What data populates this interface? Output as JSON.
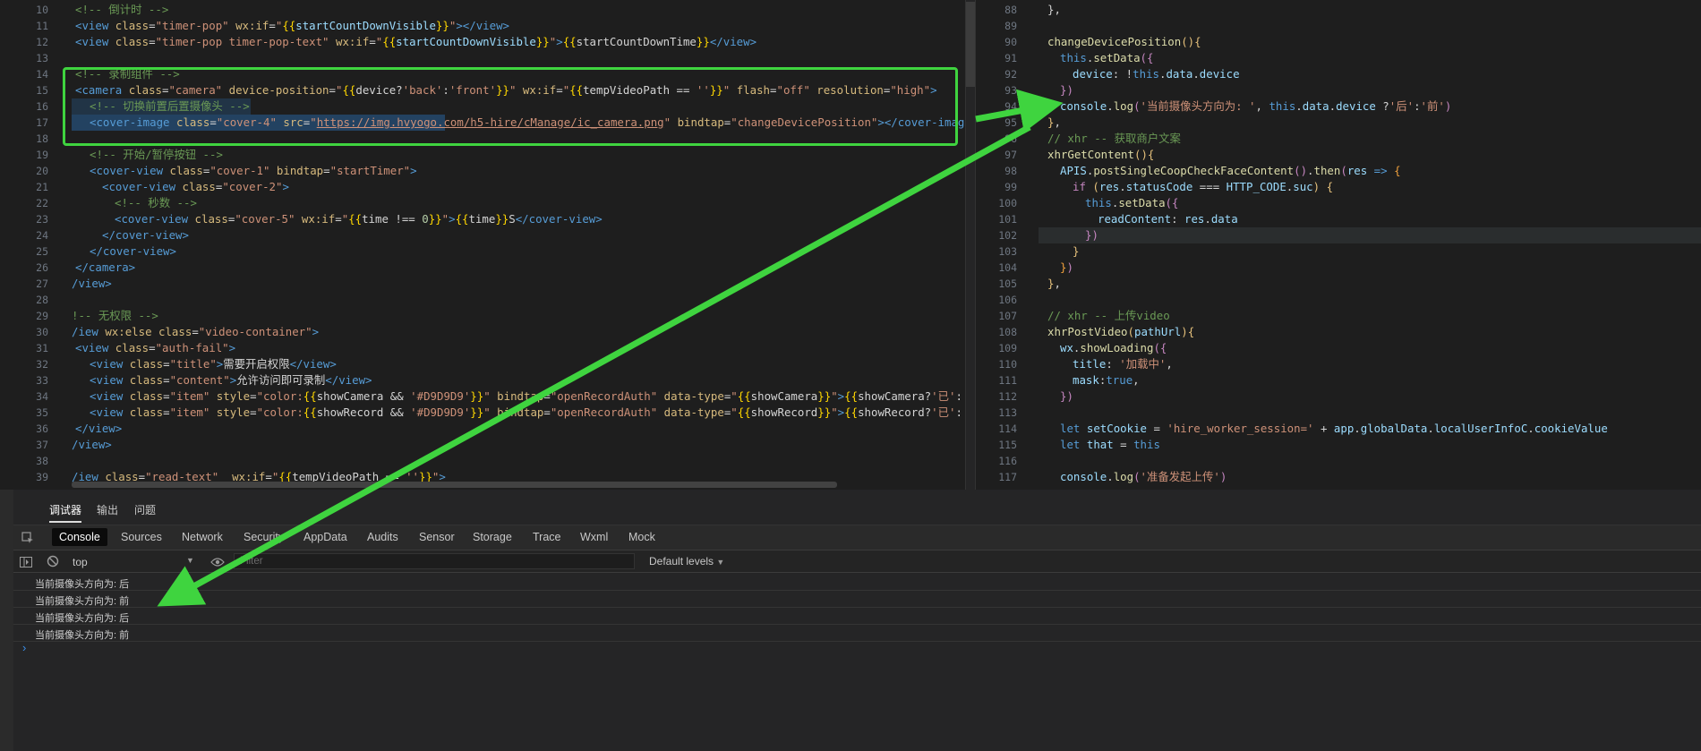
{
  "left_editor": {
    "lines": [
      {
        "n": "10",
        "html": "<span class='t-com'>&lt;!-- 倒计时 --&gt;</span>",
        "ind": 84
      },
      {
        "n": "11",
        "html": "<span class='t-tag'>&lt;view</span> <span class='t-attr'>class</span>=<span class='t-str'>\"timer-pop\"</span> <span class='t-attr'>wx:if</span>=<span class='t-str'>\"</span><span class='t-br'>{{</span><span class='t-var'>startCountDownVisible</span><span class='t-br'>}}</span><span class='t-str'>\"</span><span class='t-tag'>&gt;&lt;/view&gt;</span>",
        "ind": 84
      },
      {
        "n": "12",
        "html": "<span class='t-tag'>&lt;view</span> <span class='t-attr'>class</span>=<span class='t-str'>\"timer-pop timer-pop-text\"</span> <span class='t-attr'>wx:if</span>=<span class='t-str'>\"</span><span class='t-br'>{{</span><span class='t-var'>startCountDownVisible</span><span class='t-br'>}}</span><span class='t-str'>\"</span><span class='t-tag'>&gt;</span><span class='t-br'>{{</span>startCountDownTime<span class='t-br'>}}</span><span class='t-tag'>&lt;/view&gt;</span>",
        "ind": 84
      },
      {
        "n": "13",
        "html": "",
        "ind": 84
      },
      {
        "n": "14",
        "html": "<span class='t-com'>&lt;!-- 录制组件 --&gt;</span>",
        "ind": 84
      },
      {
        "n": "15",
        "html": "<span class='t-tag'>&lt;camera</span> <span class='t-attr'>class</span>=<span class='t-str'>\"camera\"</span> <span class='t-attr'>device-position</span>=<span class='t-str'>\"</span><span class='t-br'>{{</span>device?<span class='t-str'>'back'</span>:<span class='t-str'>'front'</span><span class='t-br'>}}</span><span class='t-str'>\"</span> <span class='t-attr'>wx:if</span>=<span class='t-str'>\"</span><span class='t-br'>{{</span>tempVideoPath == <span class='t-str'>''</span><span class='t-br'>}}</span><span class='t-str'>\"</span> <span class='t-attr'>flash</span>=<span class='t-str'>\"off\"</span> <span class='t-attr'>resolution</span>=<span class='t-str'>\"high\"</span><span class='t-tag'>&gt;</span>",
        "ind": 84
      },
      {
        "n": "16",
        "html": "<span class='t-com'>&lt;!-- 切换前置后置摄像头 --&gt;</span>",
        "ind": 100
      },
      {
        "n": "17",
        "html": "<span class='t-tag'>&lt;cover-image</span> <span class='t-attr'>class</span>=<span class='t-str'>\"cover-4\"</span> <span class='t-attr'>src</span>=<span class='t-str'>\"</span><span class='t-link'>https://img.hvyogo.com/h5-hire/cManage/ic_camera.png</span><span class='t-str'>\"</span> <span class='t-attr'>bindtap</span>=<span class='t-str'>\"changeDevicePosition\"</span><span class='t-tag'>&gt;&lt;/cover-image&gt;</span>",
        "ind": 100
      },
      {
        "n": "18",
        "html": "",
        "ind": 84
      },
      {
        "n": "19",
        "html": "<span class='t-com'>&lt;!-- 开始/暂停按钮 --&gt;</span>",
        "ind": 100
      },
      {
        "n": "20",
        "html": "<span class='t-tag'>&lt;cover-view</span> <span class='t-attr'>class</span>=<span class='t-str'>\"cover-1\"</span> <span class='t-attr'>bindtap</span>=<span class='t-str'>\"startTimer\"</span><span class='t-tag'>&gt;</span>",
        "ind": 100
      },
      {
        "n": "21",
        "html": "<span class='t-tag'>&lt;cover-view</span> <span class='t-attr'>class</span>=<span class='t-str'>\"cover-2\"</span><span class='t-tag'>&gt;</span>",
        "ind": 114
      },
      {
        "n": "22",
        "html": "<span class='t-com'>&lt;!-- 秒数 --&gt;</span>",
        "ind": 128
      },
      {
        "n": "23",
        "html": "<span class='t-tag'>&lt;cover-view</span> <span class='t-attr'>class</span>=<span class='t-str'>\"cover-5\"</span> <span class='t-attr'>wx:if</span>=<span class='t-str'>\"</span><span class='t-br'>{{</span>time !== <span class='t-num'>0</span><span class='t-br'>}}</span><span class='t-str'>\"</span><span class='t-tag'>&gt;</span><span class='t-br'>{{</span>time<span class='t-br'>}}</span>S<span class='t-tag'>&lt;/cover-view&gt;</span>",
        "ind": 128
      },
      {
        "n": "24",
        "html": "<span class='t-tag'>&lt;/cover-view&gt;</span>",
        "ind": 114
      },
      {
        "n": "25",
        "html": "<span class='t-tag'>&lt;/cover-view&gt;</span>",
        "ind": 100
      },
      {
        "n": "26",
        "html": "<span class='t-tag'>&lt;/camera&gt;</span>",
        "ind": 84
      },
      {
        "n": "27",
        "html": "<span class='t-tag'>/view&gt;</span>",
        "ind": 80
      },
      {
        "n": "28",
        "html": "",
        "ind": 80
      },
      {
        "n": "29",
        "html": "<span class='t-com'>!-- 无权限 --&gt;</span>",
        "ind": 80
      },
      {
        "n": "30",
        "html": "<span class='t-tag'>/iew</span> <span class='t-attr'>wx:else</span> <span class='t-attr'>class</span>=<span class='t-str'>\"video-container\"</span><span class='t-tag'>&gt;</span>",
        "ind": 80
      },
      {
        "n": "31",
        "html": "<span class='t-tag'>&lt;view</span> <span class='t-attr'>class</span>=<span class='t-str'>\"auth-fail\"</span><span class='t-tag'>&gt;</span>",
        "ind": 84
      },
      {
        "n": "32",
        "html": "<span class='t-tag'>&lt;view</span> <span class='t-attr'>class</span>=<span class='t-str'>\"title\"</span><span class='t-tag'>&gt;</span>需要开启权限<span class='t-tag'>&lt;/view&gt;</span>",
        "ind": 100
      },
      {
        "n": "33",
        "html": "<span class='t-tag'>&lt;view</span> <span class='t-attr'>class</span>=<span class='t-str'>\"content\"</span><span class='t-tag'>&gt;</span>允许访问即可录制<span class='t-tag'>&lt;/view&gt;</span>",
        "ind": 100
      },
      {
        "n": "34",
        "html": "<span class='t-tag'>&lt;view</span> <span class='t-attr'>class</span>=<span class='t-str'>\"item\"</span> <span class='t-attr'>style</span>=<span class='t-str'>\"color:</span><span class='t-br'>{{</span>showCamera &amp;&amp; <span class='t-str'>'#D9D9D9'</span><span class='t-br'>}}</span><span class='t-str'>\"</span> <span class='t-attr'>bindtap</span>=<span class='t-str'>\"openRecordAuth\"</span> <span class='t-attr'>data-type</span>=<span class='t-str'>\"</span><span class='t-br'>{{</span>showCamera<span class='t-br'>}}</span><span class='t-str'>\"</span><span class='t-tag'>&gt;</span><span class='t-br'>{{</span>showCamera?<span class='t-str'>'已'</span>:<span class='t-str'>''</span><span class='t-br'>}}</span>启用",
        "ind": 100
      },
      {
        "n": "35",
        "html": "<span class='t-tag'>&lt;view</span> <span class='t-attr'>class</span>=<span class='t-str'>\"item\"</span> <span class='t-attr'>style</span>=<span class='t-str'>\"color:</span><span class='t-br'>{{</span>showRecord &amp;&amp; <span class='t-str'>'#D9D9D9'</span><span class='t-br'>}}</span><span class='t-str'>\"</span> <span class='t-attr'>bindtap</span>=<span class='t-str'>\"openRecordAuth\"</span> <span class='t-attr'>data-type</span>=<span class='t-str'>\"</span><span class='t-br'>{{</span>showRecord<span class='t-br'>}}</span><span class='t-str'>\"</span><span class='t-tag'>&gt;</span><span class='t-br'>{{</span>showRecord?<span class='t-str'>'已'</span>:<span class='t-str'>''</span><span class='t-br'>}}</span>启用",
        "ind": 100
      },
      {
        "n": "36",
        "html": "<span class='t-tag'>&lt;/view&gt;</span>",
        "ind": 84
      },
      {
        "n": "37",
        "html": "<span class='t-tag'>/view&gt;</span>",
        "ind": 80
      },
      {
        "n": "38",
        "html": "",
        "ind": 80
      },
      {
        "n": "39",
        "html": "<span class='t-tag'>/iew</span> <span class='t-attr'>class</span>=<span class='t-str'>\"read-text\"</span>  <span class='t-attr'>wx:if</span>=<span class='t-str'>\"</span><span class='t-br'>{{</span>tempVideoPath == <span class='t-str'>''</span><span class='t-br'>}}</span><span class='t-str'>\"</span><span class='t-tag'>&gt;</span>",
        "ind": 80
      }
    ]
  },
  "right_editor": {
    "lines": [
      {
        "n": "88",
        "html": "<span class='t-txt'>},</span>",
        "ind": 80
      },
      {
        "n": "89",
        "html": "",
        "ind": 80
      },
      {
        "n": "90",
        "html": "<span class='t-fn'>changeDevicePosition</span><span class='t-y'>()</span><span class='t-y'>{</span>",
        "ind": 80
      },
      {
        "n": "91",
        "html": "<span class='t-kw'>this</span>.<span class='t-fn'>setData</span><span class='t-key'>({</span>",
        "ind": 94
      },
      {
        "n": "92",
        "html": "<span class='t-var'>device</span>: !<span class='t-kw'>this</span>.<span class='t-var'>data</span>.<span class='t-var'>device</span>",
        "ind": 108
      },
      {
        "n": "93",
        "html": "<span class='t-key'>})</span>",
        "ind": 94
      },
      {
        "n": "94",
        "html": "<span class='t-var'>console</span>.<span class='t-fn'>log</span><span class='t-key'>(</span><span class='t-str'>'当前摄像头方向为: '</span>, <span class='t-kw'>this</span>.<span class='t-var'>data</span>.<span class='t-var'>device</span> ?<span class='t-str'>'后'</span>:<span class='t-str'>'前'</span><span class='t-key'>)</span>",
        "ind": 94
      },
      {
        "n": "95",
        "html": "<span class='t-y'>}</span>,",
        "ind": 80
      },
      {
        "n": "96",
        "html": "<span class='t-com'>// xhr -- 获取商户文案</span>",
        "ind": 80
      },
      {
        "n": "97",
        "html": "<span class='t-fn'>xhrGetContent</span><span class='t-y'>()</span><span class='t-y'>{</span>",
        "ind": 80
      },
      {
        "n": "98",
        "html": "<span class='t-var'>APIS</span>.<span class='t-fn'>postSingleCoopCheckFaceContent</span><span class='t-key'>()</span>.<span class='t-fn'>then</span><span class='t-key'>(</span><span class='t-var'>res</span> <span class='t-kw'>=&gt;</span> <span class='t-o'>{</span>",
        "ind": 94
      },
      {
        "n": "99",
        "html": "<span class='t-key'>if</span> <span class='t-y'>(</span><span class='t-var'>res</span>.<span class='t-var'>statusCode</span> === <span class='t-var'>HTTP_CODE</span>.<span class='t-var'>suc</span><span class='t-y'>)</span> <span class='t-y'>{</span>",
        "ind": 108
      },
      {
        "n": "100",
        "html": "<span class='t-kw'>this</span>.<span class='t-fn'>setData</span><span class='t-key'>({</span>",
        "ind": 122
      },
      {
        "n": "101",
        "html": "<span class='t-var'>readContent</span>: <span class='t-var'>res</span>.<span class='t-var'>data</span>",
        "ind": 136
      },
      {
        "n": "102",
        "html": "<span class='t-key'>})</span>",
        "ind": 122
      },
      {
        "n": "103",
        "html": "<span class='t-y'>}</span>",
        "ind": 108
      },
      {
        "n": "104",
        "html": "<span class='t-o'>}</span><span class='t-key'>)</span>",
        "ind": 94
      },
      {
        "n": "105",
        "html": "<span class='t-y'>}</span>,",
        "ind": 80
      },
      {
        "n": "106",
        "html": "",
        "ind": 80
      },
      {
        "n": "107",
        "html": "<span class='t-com'>// xhr -- 上传video</span>",
        "ind": 80
      },
      {
        "n": "108",
        "html": "<span class='t-fn'>xhrPostVideo</span><span class='t-y'>(</span><span class='t-var'>pathUrl</span><span class='t-y'>)</span><span class='t-y'>{</span>",
        "ind": 80
      },
      {
        "n": "109",
        "html": "<span class='t-var'>wx</span>.<span class='t-fn'>showLoading</span><span class='t-key'>({</span>",
        "ind": 94
      },
      {
        "n": "110",
        "html": "<span class='t-var'>title</span>: <span class='t-str'>'加载中'</span>,",
        "ind": 108
      },
      {
        "n": "111",
        "html": "<span class='t-var'>mask</span>:<span class='t-kw'>true</span>,",
        "ind": 108
      },
      {
        "n": "112",
        "html": "<span class='t-key'>})</span>",
        "ind": 94
      },
      {
        "n": "113",
        "html": "",
        "ind": 94
      },
      {
        "n": "114",
        "html": "<span class='t-kw'>let</span> <span class='t-var'>setCookie</span> = <span class='t-str'>'hire_worker_session='</span> + <span class='t-var'>app</span>.<span class='t-var'>globalData</span>.<span class='t-var'>localUserInfoC</span>.<span class='t-var'>cookieValue</span>",
        "ind": 94
      },
      {
        "n": "115",
        "html": "<span class='t-kw'>let</span> <span class='t-var'>that</span> = <span class='t-kw'>this</span>",
        "ind": 94
      },
      {
        "n": "116",
        "html": "",
        "ind": 94
      },
      {
        "n": "117",
        "html": "<span class='t-var'>console</span>.<span class='t-fn'>log</span><span class='t-key'>(</span><span class='t-str'>'准备发起上传'</span><span class='t-key'>)</span>",
        "ind": 94
      }
    ]
  },
  "debug_tabs": [
    "调试器",
    "输出",
    "问题"
  ],
  "devtools_tabs": [
    "Console",
    "Sources",
    "Network",
    "Security",
    "AppData",
    "Audits",
    "Sensor",
    "Storage",
    "Trace",
    "Wxml",
    "Mock"
  ],
  "toolbar": {
    "context": "top",
    "filter_placeholder": "Filter",
    "levels": "Default levels"
  },
  "console_logs": [
    {
      "text": "当前摄像头方向为:  后"
    },
    {
      "text": "当前摄像头方向为:  前"
    },
    {
      "text": "当前摄像头方向为:  后"
    },
    {
      "text": "当前摄像头方向为:  前"
    }
  ],
  "colors": {
    "annotation": "#3fd43f",
    "active_tab_bg": "#0b0b0b"
  }
}
